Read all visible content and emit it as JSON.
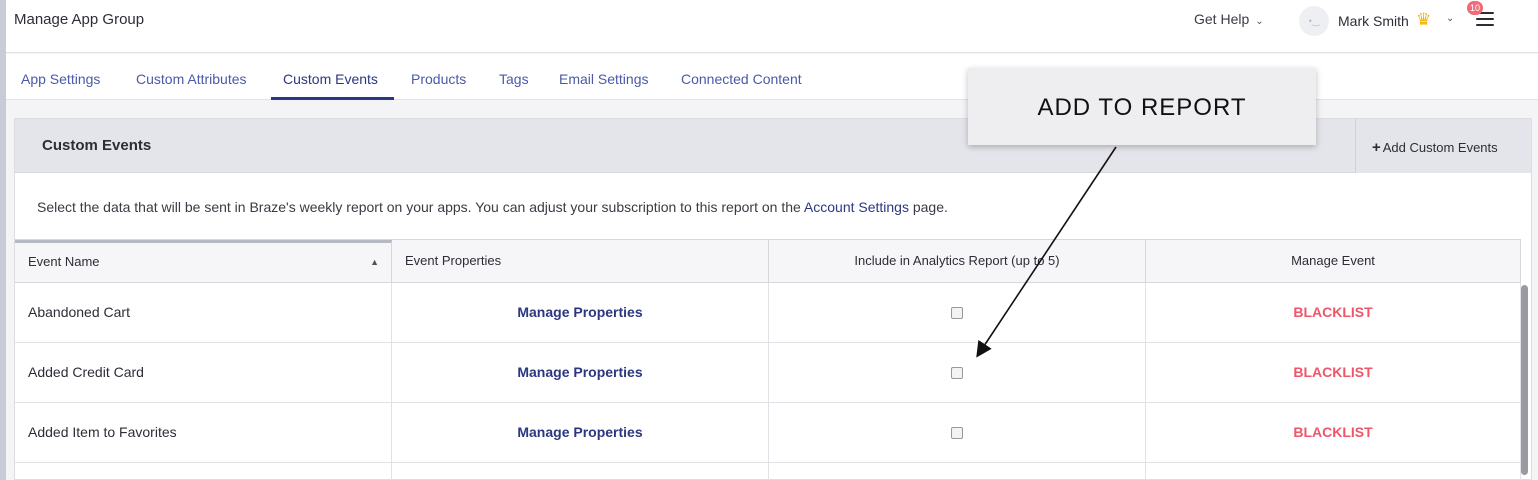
{
  "header": {
    "app_title": "Manage App Group",
    "get_help": "Get Help",
    "user_name": "Mark Smith",
    "notification_count": "10",
    "icons": [
      "chevron-down-icon",
      "avatar-icon",
      "crown-icon",
      "menu-icon"
    ]
  },
  "tabs": [
    {
      "label": "App Settings",
      "active": false
    },
    {
      "label": "Custom Attributes",
      "active": false
    },
    {
      "label": "Custom Events",
      "active": true
    },
    {
      "label": "Products",
      "active": false
    },
    {
      "label": "Tags",
      "active": false
    },
    {
      "label": "Email Settings",
      "active": false
    },
    {
      "label": "Connected Content",
      "active": false
    }
  ],
  "panel": {
    "title": "Custom Events",
    "add_button": "Add Custom Events",
    "description_prefix": "Select the data that will be sent in Braze's weekly report on your apps. You can adjust your subscription to this report on the",
    "description_link": "Account Settings",
    "description_suffix": "page."
  },
  "table": {
    "columns": [
      "Event Name",
      "Event Properties",
      "Include in Analytics Report (up to 5)",
      "Manage Event"
    ],
    "rows": [
      {
        "name": "Abandoned Cart",
        "properties_link": "Manage Properties",
        "included": false,
        "action": "BLACKLIST"
      },
      {
        "name": "Added Credit Card",
        "properties_link": "Manage Properties",
        "included": false,
        "action": "BLACKLIST"
      },
      {
        "name": "Added Item to Favorites",
        "properties_link": "Manage Properties",
        "included": false,
        "action": "BLACKLIST"
      }
    ]
  },
  "annotation": {
    "callout_text": "ADD TO REPORT"
  },
  "colors": {
    "link": "#2b3780",
    "tab": "#4a5aa8",
    "blacklist": "#f0566a",
    "header_bg": "#e4e5ea",
    "notification": "#f06a7a",
    "crown": "#f2b600"
  }
}
